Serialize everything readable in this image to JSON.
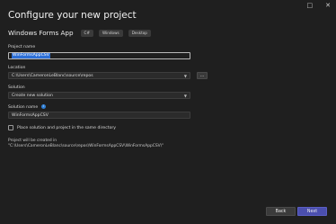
{
  "window": {
    "controls": [
      "□",
      "✕"
    ]
  },
  "page": {
    "title": "Configure your new project"
  },
  "template": {
    "name": "Windows Forms App",
    "tags": [
      "C#",
      "Windows",
      "Desktop"
    ]
  },
  "form": {
    "project_name_label": "Project name",
    "project_name_value": "WinFormsAppCSV",
    "location_label": "Location",
    "location_value": "C:\\Users\\CameronLeBlanc\\source\\repos",
    "browse_label": "...",
    "solution_label": "Solution",
    "solution_value": "Create new solution",
    "solution_name_label": "Solution name",
    "info_glyph": "i",
    "solution_name_value": "WinFormsAppCSV",
    "same_directory_label": "Place solution and project in the same directory",
    "same_directory_checked": false,
    "note": "Project will be created in \"C:\\Users\\CameronLeBlanc\\source\\repos\\WinFormsAppCSV\\WinFormsAppCSV\\\""
  },
  "footer": {
    "back_label": "Back",
    "next_label": "Next"
  },
  "colors": {
    "background": "#1f1f1f",
    "accent": "#4b4fae",
    "selection": "#2d6fd6"
  }
}
